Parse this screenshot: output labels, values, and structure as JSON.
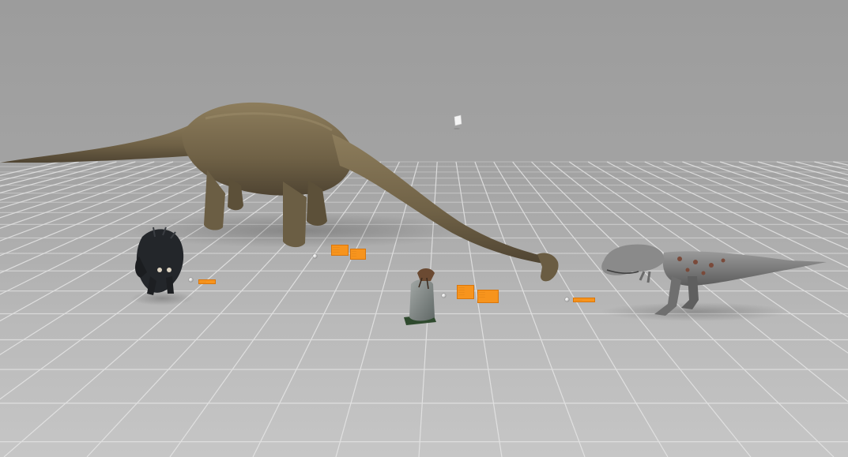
{
  "scene": {
    "description_free": true,
    "background_color": "#a8a8a8",
    "grid_color": "#e9e9e9"
  },
  "objects": [
    {
      "id": "brachiosaurus",
      "icon": "long-neck-dinosaur-icon",
      "color": "#7a6a4b"
    },
    {
      "id": "triceratops",
      "icon": "horned-dinosaur-icon",
      "color": "#23262a"
    },
    {
      "id": "t-rex",
      "icon": "theropod-dinosaur-icon",
      "color": "#7c7c7c"
    },
    {
      "id": "bird-on-rock",
      "icon": "bird-statue-icon",
      "color": "#8a8f8c"
    },
    {
      "id": "floating-marker",
      "icon": "small-card-icon",
      "color": "#f2f2f2"
    }
  ],
  "annotations": {
    "triceratops_tag": "········",
    "brachio_tag_left": "·········\n·········\n·········",
    "brachio_tag_right": "······\n······\n······",
    "bird_tag_left": "········\n········\n········\n········",
    "bird_tag_right": "········\n········\n········",
    "trex_tag": "··········",
    "accent_color": "#f7941d"
  }
}
